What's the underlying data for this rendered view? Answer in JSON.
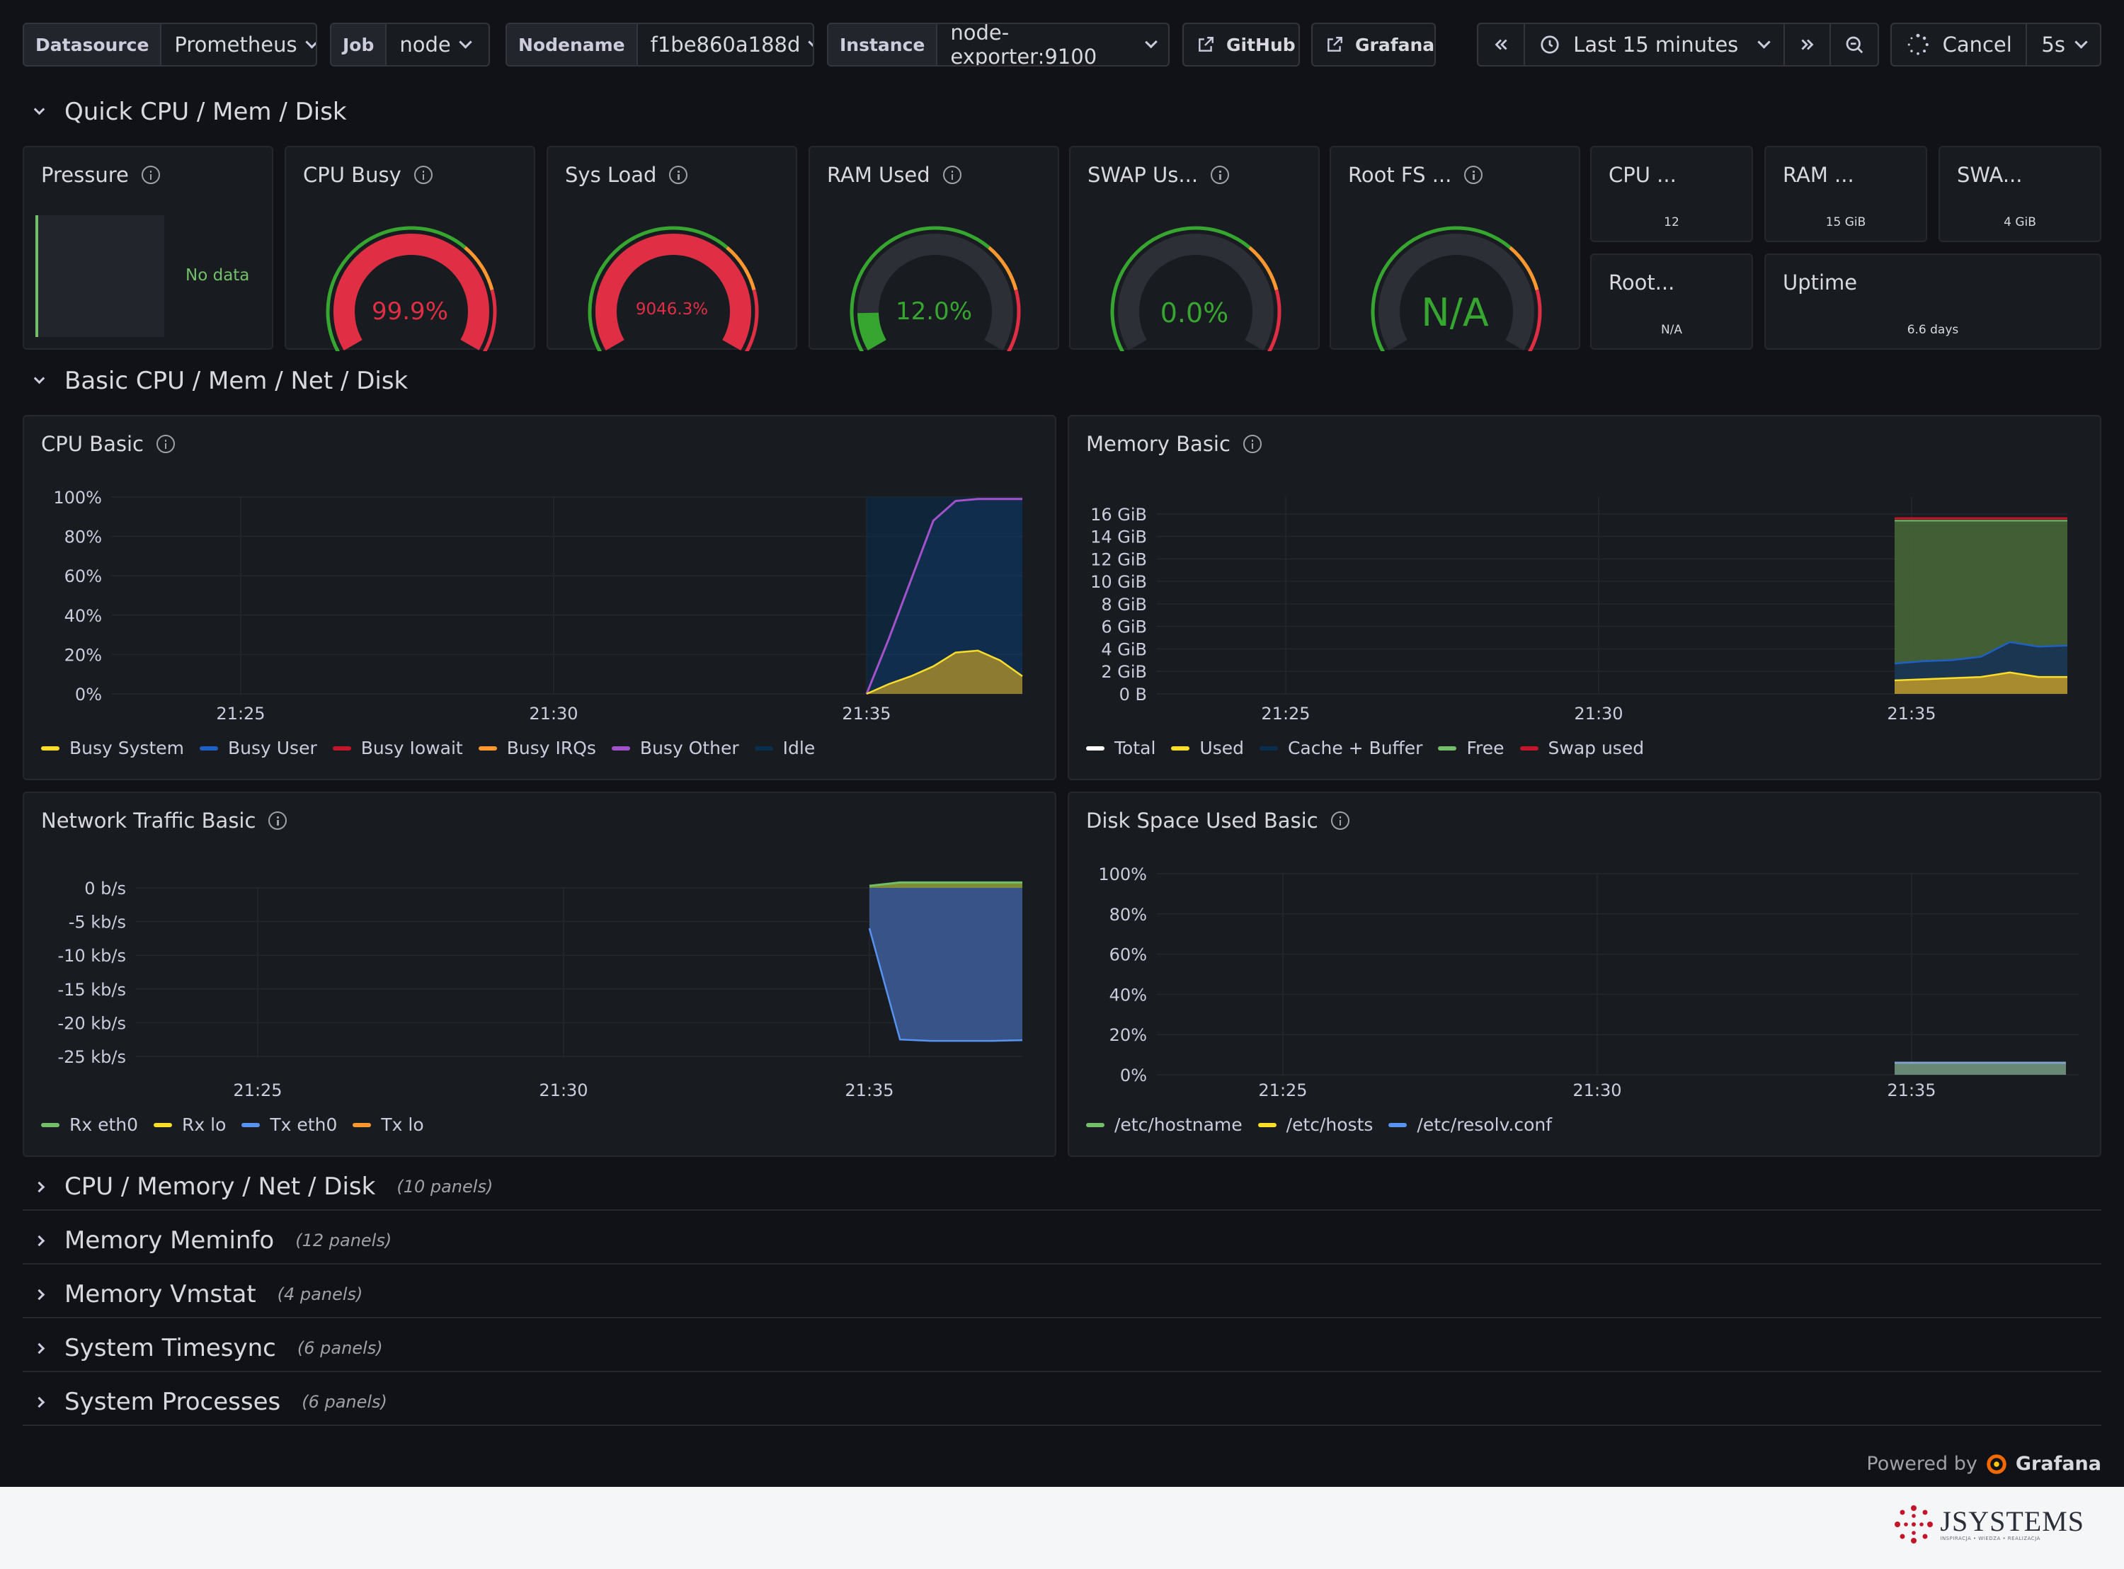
{
  "toolbar": {
    "datasource_label": "Datasource",
    "datasource_value": "Prometheus",
    "job_label": "Job",
    "job_value": "node",
    "nodename_label": "Nodename",
    "nodename_value": "f1be860a188d",
    "instance_label": "Instance",
    "instance_value": "node-exporter:9100",
    "github_label": "GitHub",
    "grafana_label": "Grafana",
    "time_range": "Last 15 minutes",
    "cancel_label": "Cancel",
    "refresh_interval": "5s"
  },
  "rows": {
    "quick": "Quick CPU / Mem / Disk",
    "basic": "Basic CPU / Mem / Net / Disk",
    "collapsed": [
      {
        "title": "CPU / Memory / Net / Disk",
        "count": "(10 panels)"
      },
      {
        "title": "Memory Meminfo",
        "count": "(12 panels)"
      },
      {
        "title": "Memory Vmstat",
        "count": "(4 panels)"
      },
      {
        "title": "System Timesync",
        "count": "(6 panels)"
      },
      {
        "title": "System Processes",
        "count": "(6 panels)"
      }
    ]
  },
  "quick_panels": {
    "pressure": {
      "title": "Pressure",
      "value": "No data"
    },
    "cpu_busy": {
      "title": "CPU Busy",
      "value": "99.9%",
      "fraction": 0.999,
      "color": "#e02f44"
    },
    "sys_load": {
      "title": "Sys Load",
      "value": "9046.3%",
      "fraction": 1.0,
      "color": "#e02f44"
    },
    "ram_used": {
      "title": "RAM Used",
      "value": "12.0%",
      "fraction": 0.12,
      "color": "#37a631"
    },
    "swap_used": {
      "title": "SWAP Us...",
      "value": "0.0%",
      "fraction": 0.0,
      "color": "#37a631"
    },
    "root_fs": {
      "title": "Root FS ...",
      "value": "N/A",
      "fraction": 0.0,
      "color": "#37a631"
    },
    "cpu_cores": {
      "title": "CPU ...",
      "value": "12"
    },
    "ram_total": {
      "title": "RAM ...",
      "value": "15 GiB"
    },
    "swap_total": {
      "title": "SWA...",
      "value": "4 GiB"
    },
    "root_total": {
      "title": "Root...",
      "value": "N/A"
    },
    "uptime": {
      "title": "Uptime",
      "value": "6.6 days"
    }
  },
  "panels": {
    "cpu_basic": {
      "title": "CPU Basic"
    },
    "memory_basic": {
      "title": "Memory Basic"
    },
    "network_basic": {
      "title": "Network Traffic Basic"
    },
    "disk_basic": {
      "title": "Disk Space Used Basic"
    }
  },
  "chart_data": [
    {
      "type": "area",
      "title": "CPU Basic",
      "x_ticks": [
        "21:25",
        "21:30",
        "21:35"
      ],
      "y_ticks": [
        "100%",
        "80%",
        "60%",
        "40%",
        "20%",
        "0%"
      ],
      "ylim": [
        0,
        100
      ],
      "x": [
        "21:35:00",
        "21:35:30",
        "21:36:00",
        "21:36:30",
        "21:37:00",
        "21:37:30",
        "21:38:00",
        "21:38:30"
      ],
      "series": [
        {
          "name": "Busy System",
          "color": "#fade2a",
          "values": [
            0,
            5,
            9,
            14,
            21,
            22,
            17,
            9
          ]
        },
        {
          "name": "Busy User",
          "color": "#1f60c4",
          "values": [
            0,
            28,
            58,
            88,
            98,
            99,
            99,
            99
          ]
        },
        {
          "name": "Busy Iowait",
          "color": "#c4162a",
          "values": []
        },
        {
          "name": "Busy IRQs",
          "color": "#ff9830",
          "values": []
        },
        {
          "name": "Busy Other",
          "color": "#a352cc",
          "values": []
        },
        {
          "name": "Idle",
          "color": "#0a2e4f",
          "values": []
        }
      ]
    },
    {
      "type": "area",
      "title": "Memory Basic",
      "x_ticks": [
        "21:25",
        "21:30",
        "21:35"
      ],
      "y_ticks": [
        "16 GiB",
        "14 GiB",
        "12 GiB",
        "10 GiB",
        "8 GiB",
        "6 GiB",
        "4 GiB",
        "2 GiB",
        "0 B"
      ],
      "ylim": [
        0,
        17.5
      ],
      "x": [
        "21:35:00",
        "21:35:40",
        "21:36:20",
        "21:37:00",
        "21:37:30",
        "21:38:00",
        "21:38:20"
      ],
      "series": [
        {
          "name": "Total",
          "color": "#ffffff",
          "values": [
            15.4,
            15.4,
            15.4,
            15.4,
            15.4,
            15.4,
            15.4
          ]
        },
        {
          "name": "Used",
          "color": "#fade2a",
          "values": [
            1.2,
            1.3,
            1.4,
            1.5,
            1.9,
            1.5,
            1.5
          ]
        },
        {
          "name": "Cache + Buffer",
          "color": "#0a2e4f",
          "values": [
            2.7,
            2.9,
            3.0,
            3.3,
            4.6,
            4.2,
            4.3
          ]
        },
        {
          "name": "Free",
          "color": "#73bf69",
          "values": [
            15.4,
            15.4,
            15.4,
            15.4,
            15.4,
            15.4,
            15.4
          ]
        },
        {
          "name": "Swap used",
          "color": "#c4162a",
          "values": [
            15.6,
            15.6,
            15.6,
            15.6,
            15.6,
            15.6,
            15.6
          ]
        }
      ]
    },
    {
      "type": "area",
      "title": "Network Traffic Basic",
      "x_ticks": [
        "21:25",
        "21:30",
        "21:35"
      ],
      "y_ticks": [
        "0 b/s",
        "-5 kb/s",
        "-10 kb/s",
        "-15 kb/s",
        "-20 kb/s",
        "-25 kb/s"
      ],
      "ylim": [
        -25,
        0
      ],
      "x": [
        "21:35:00",
        "21:35:40",
        "21:36:20",
        "21:37:00",
        "21:37:40",
        "21:38:20"
      ],
      "series": [
        {
          "name": "Rx eth0",
          "color": "#73bf69",
          "values": [
            0.3,
            0.8,
            0.8,
            0.8,
            0.8,
            0.8
          ]
        },
        {
          "name": "Rx lo",
          "color": "#fade2a",
          "values": []
        },
        {
          "name": "Tx eth0",
          "color": "#5794f2",
          "values": [
            -6,
            -22.5,
            -22.7,
            -22.7,
            -22.7,
            -22.6
          ]
        },
        {
          "name": "Tx lo",
          "color": "#ff9830",
          "values": []
        }
      ]
    },
    {
      "type": "area",
      "title": "Disk Space Used Basic",
      "x_ticks": [
        "21:25",
        "21:30",
        "21:35"
      ],
      "y_ticks": [
        "100%",
        "80%",
        "60%",
        "40%",
        "20%",
        "0%"
      ],
      "ylim": [
        0,
        100
      ],
      "x": [
        "21:35:00",
        "21:38:20"
      ],
      "series": [
        {
          "name": "/etc/hostname",
          "color": "#73bf69",
          "values": [
            6,
            6
          ]
        },
        {
          "name": "/etc/hosts",
          "color": "#fade2a",
          "values": [
            6,
            6
          ]
        },
        {
          "name": "/etc/resolv.conf",
          "color": "#5794f2",
          "values": [
            6,
            6
          ]
        }
      ]
    }
  ],
  "footer": {
    "powered_by": "Powered by",
    "grafana_brand": "Grafana",
    "logo_text": "JSYSTEMS",
    "logo_tagline": "INSPIRACJA • WIEDZA • REALIZACJA"
  }
}
